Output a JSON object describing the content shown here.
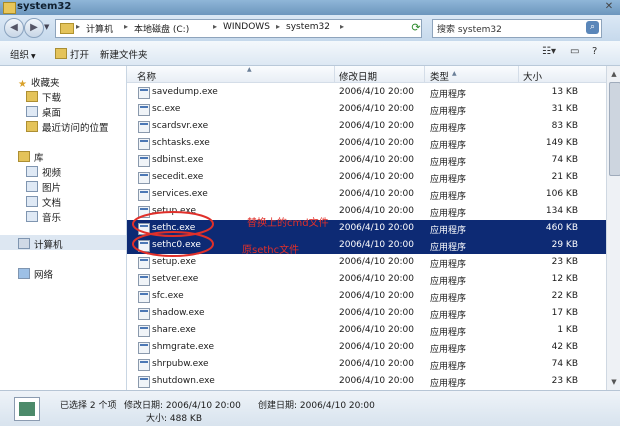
{
  "window": {
    "title": "system32",
    "close_glyph": "✕"
  },
  "address": {
    "crumbs": [
      "计算机",
      "本地磁盘 (C:)",
      "WINDOWS",
      "system32"
    ],
    "separator": "▸",
    "search_placeholder": "搜索 system32"
  },
  "toolbar": {
    "organize": "组织",
    "open": "打开",
    "new_folder": "新建文件夹"
  },
  "sidebar": {
    "favorites": "收藏夹",
    "downloads": "下载",
    "desktop": "桌面",
    "recent": "最近访问的位置",
    "libraries": "库",
    "videos": "视频",
    "pictures": "图片",
    "documents": "文档",
    "music": "音乐",
    "computer": "计算机",
    "network": "网络"
  },
  "columns": {
    "name": "名称",
    "date": "修改日期",
    "type": "类型",
    "size": "大小"
  },
  "files": [
    {
      "name": "savedump.exe",
      "date": "2006/4/10 20:00",
      "type": "应用程序",
      "size": "13 KB",
      "selected": false
    },
    {
      "name": "sc.exe",
      "date": "2006/4/10 20:00",
      "type": "应用程序",
      "size": "31 KB",
      "selected": false
    },
    {
      "name": "scardsvr.exe",
      "date": "2006/4/10 20:00",
      "type": "应用程序",
      "size": "83 KB",
      "selected": false
    },
    {
      "name": "schtasks.exe",
      "date": "2006/4/10 20:00",
      "type": "应用程序",
      "size": "149 KB",
      "selected": false
    },
    {
      "name": "sdbinst.exe",
      "date": "2006/4/10 20:00",
      "type": "应用程序",
      "size": "74 KB",
      "selected": false
    },
    {
      "name": "secedit.exe",
      "date": "2006/4/10 20:00",
      "type": "应用程序",
      "size": "21 KB",
      "selected": false
    },
    {
      "name": "services.exe",
      "date": "2006/4/10 20:00",
      "type": "应用程序",
      "size": "106 KB",
      "selected": false
    },
    {
      "name": "setup.exe",
      "date": "2006/4/10 20:00",
      "type": "应用程序",
      "size": "134 KB",
      "selected": false
    },
    {
      "name": "sethc.exe",
      "date": "2006/4/10 20:00",
      "type": "应用程序",
      "size": "460 KB",
      "selected": true
    },
    {
      "name": "sethc0.exe",
      "date": "2006/4/10 20:00",
      "type": "应用程序",
      "size": "29 KB",
      "selected": true
    },
    {
      "name": "setup.exe",
      "date": "2006/4/10 20:00",
      "type": "应用程序",
      "size": "23 KB",
      "selected": false
    },
    {
      "name": "setver.exe",
      "date": "2006/4/10 20:00",
      "type": "应用程序",
      "size": "12 KB",
      "selected": false
    },
    {
      "name": "sfc.exe",
      "date": "2006/4/10 20:00",
      "type": "应用程序",
      "size": "22 KB",
      "selected": false
    },
    {
      "name": "shadow.exe",
      "date": "2006/4/10 20:00",
      "type": "应用程序",
      "size": "17 KB",
      "selected": false
    },
    {
      "name": "share.exe",
      "date": "2006/4/10 20:00",
      "type": "应用程序",
      "size": "1 KB",
      "selected": false
    },
    {
      "name": "shmgrate.exe",
      "date": "2006/4/10 20:00",
      "type": "应用程序",
      "size": "42 KB",
      "selected": false
    },
    {
      "name": "shrpubw.exe",
      "date": "2006/4/10 20:00",
      "type": "应用程序",
      "size": "74 KB",
      "selected": false
    },
    {
      "name": "shutdown.exe",
      "date": "2006/4/10 20:00",
      "type": "应用程序",
      "size": "23 KB",
      "selected": false
    }
  ],
  "annotations": {
    "replaced": "替换上的cmd文件",
    "original": "原sethc文件",
    "color": "#e0302a"
  },
  "status": {
    "selected": "已选择 2 个项",
    "modified": "修改日期: 2006/4/10 20:00",
    "created": "创建日期: 2006/4/10 20:00",
    "size": "大小: 488 KB"
  },
  "colors": {
    "selection": "#0d2a74",
    "accent": "#5a86b9"
  }
}
